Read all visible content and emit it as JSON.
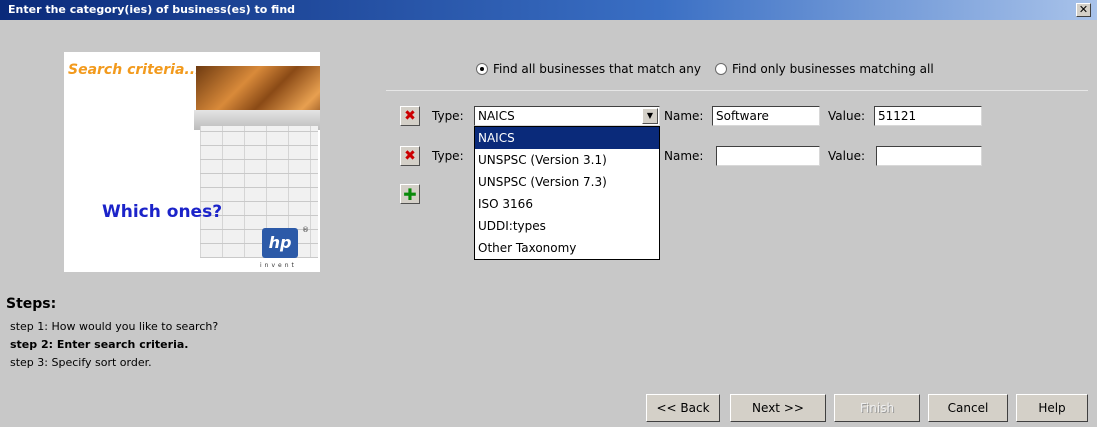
{
  "window": {
    "title": "Enter the category(ies) of business(es) to find",
    "close_glyph": "✕"
  },
  "banner": {
    "search_text": "Search criteria...",
    "which_text": "Which ones?",
    "logo_text": "hp",
    "logo_tagline": "invent",
    "logo_reg": "®"
  },
  "steps": {
    "heading": "Steps:",
    "items": [
      {
        "label": "step 1: How would you like to search?",
        "current": false
      },
      {
        "label": "step 2: Enter search criteria.",
        "current": true
      },
      {
        "label": "step 3: Specify sort order.",
        "current": false
      }
    ]
  },
  "match_mode": {
    "options": [
      {
        "label": "Find all businesses that match any",
        "selected": true
      },
      {
        "label": "Find only businesses matching all",
        "selected": false
      }
    ]
  },
  "criteria_rows": [
    {
      "type_label": "Type:",
      "type_value": "NAICS",
      "name_label": "Name:",
      "name_value": "Software",
      "value_label": "Value:",
      "value_value": "51121"
    },
    {
      "type_label": "Type:",
      "type_value": "",
      "name_label": "Name:",
      "name_value": "",
      "value_label": "Value:",
      "value_value": ""
    }
  ],
  "type_dropdown": {
    "options": [
      "NAICS",
      "UNSPSC (Version 3.1)",
      "UNSPSC (Version 7.3)",
      "ISO 3166",
      "UDDI:types",
      "Other Taxonomy"
    ],
    "highlighted": "NAICS"
  },
  "icons": {
    "delete_glyph": "✖",
    "add_glyph": "✚",
    "arrow_glyph": "▼"
  },
  "buttons": {
    "back": "<< Back",
    "next": "Next >>",
    "finish": "Finish",
    "cancel": "Cancel",
    "help": "Help"
  },
  "colors": {
    "title_bar": "#0a2a7a",
    "highlight": "#0a2a7a",
    "which_ones": "#1b23c9",
    "search_criteria": "#f29a1d"
  }
}
